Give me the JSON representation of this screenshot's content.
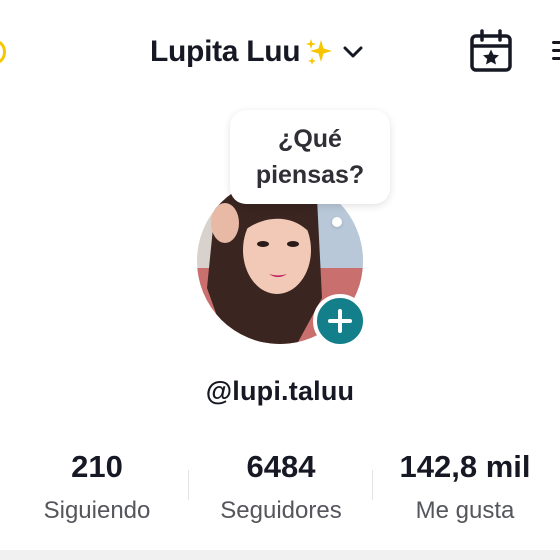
{
  "header": {
    "title": "Lupita Luu",
    "title_emoji_icon": "sparkles-icon",
    "dropdown_icon": "chevron-down-icon",
    "calendar_icon": "calendar-star-icon"
  },
  "profile": {
    "note_bubble": {
      "line1": "¿Qué",
      "line2": "piensas?"
    },
    "add_icon": "plus-icon",
    "username": "@lupi.taluu"
  },
  "stats": [
    {
      "value": "210",
      "label": "Siguiendo"
    },
    {
      "value": "6484",
      "label": "Seguidores"
    },
    {
      "value": "142,8 mil",
      "label": "Me gusta"
    }
  ],
  "colors": {
    "accent_teal": "#137f8a",
    "sparkle_yellow": "#f7c600",
    "text_primary": "#161823",
    "text_secondary": "#55565c"
  }
}
